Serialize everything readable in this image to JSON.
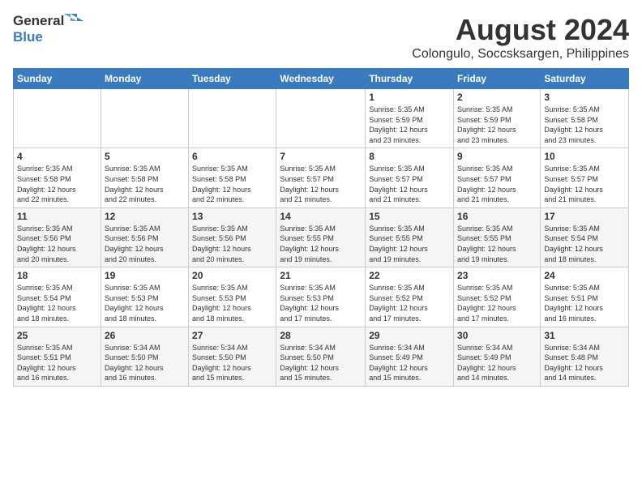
{
  "logo": {
    "general": "General",
    "blue": "Blue"
  },
  "title": "August 2024",
  "subtitle": "Colongulo, Soccsksargen, Philippines",
  "days": [
    "Sunday",
    "Monday",
    "Tuesday",
    "Wednesday",
    "Thursday",
    "Friday",
    "Saturday"
  ],
  "weeks": [
    [
      {
        "day": "",
        "info": ""
      },
      {
        "day": "",
        "info": ""
      },
      {
        "day": "",
        "info": ""
      },
      {
        "day": "",
        "info": ""
      },
      {
        "day": "1",
        "info": "Sunrise: 5:35 AM\nSunset: 5:59 PM\nDaylight: 12 hours\nand 23 minutes."
      },
      {
        "day": "2",
        "info": "Sunrise: 5:35 AM\nSunset: 5:59 PM\nDaylight: 12 hours\nand 23 minutes."
      },
      {
        "day": "3",
        "info": "Sunrise: 5:35 AM\nSunset: 5:58 PM\nDaylight: 12 hours\nand 23 minutes."
      }
    ],
    [
      {
        "day": "4",
        "info": "Sunrise: 5:35 AM\nSunset: 5:58 PM\nDaylight: 12 hours\nand 22 minutes."
      },
      {
        "day": "5",
        "info": "Sunrise: 5:35 AM\nSunset: 5:58 PM\nDaylight: 12 hours\nand 22 minutes."
      },
      {
        "day": "6",
        "info": "Sunrise: 5:35 AM\nSunset: 5:58 PM\nDaylight: 12 hours\nand 22 minutes."
      },
      {
        "day": "7",
        "info": "Sunrise: 5:35 AM\nSunset: 5:57 PM\nDaylight: 12 hours\nand 21 minutes."
      },
      {
        "day": "8",
        "info": "Sunrise: 5:35 AM\nSunset: 5:57 PM\nDaylight: 12 hours\nand 21 minutes."
      },
      {
        "day": "9",
        "info": "Sunrise: 5:35 AM\nSunset: 5:57 PM\nDaylight: 12 hours\nand 21 minutes."
      },
      {
        "day": "10",
        "info": "Sunrise: 5:35 AM\nSunset: 5:57 PM\nDaylight: 12 hours\nand 21 minutes."
      }
    ],
    [
      {
        "day": "11",
        "info": "Sunrise: 5:35 AM\nSunset: 5:56 PM\nDaylight: 12 hours\nand 20 minutes."
      },
      {
        "day": "12",
        "info": "Sunrise: 5:35 AM\nSunset: 5:56 PM\nDaylight: 12 hours\nand 20 minutes."
      },
      {
        "day": "13",
        "info": "Sunrise: 5:35 AM\nSunset: 5:56 PM\nDaylight: 12 hours\nand 20 minutes."
      },
      {
        "day": "14",
        "info": "Sunrise: 5:35 AM\nSunset: 5:55 PM\nDaylight: 12 hours\nand 19 minutes."
      },
      {
        "day": "15",
        "info": "Sunrise: 5:35 AM\nSunset: 5:55 PM\nDaylight: 12 hours\nand 19 minutes."
      },
      {
        "day": "16",
        "info": "Sunrise: 5:35 AM\nSunset: 5:55 PM\nDaylight: 12 hours\nand 19 minutes."
      },
      {
        "day": "17",
        "info": "Sunrise: 5:35 AM\nSunset: 5:54 PM\nDaylight: 12 hours\nand 18 minutes."
      }
    ],
    [
      {
        "day": "18",
        "info": "Sunrise: 5:35 AM\nSunset: 5:54 PM\nDaylight: 12 hours\nand 18 minutes."
      },
      {
        "day": "19",
        "info": "Sunrise: 5:35 AM\nSunset: 5:53 PM\nDaylight: 12 hours\nand 18 minutes."
      },
      {
        "day": "20",
        "info": "Sunrise: 5:35 AM\nSunset: 5:53 PM\nDaylight: 12 hours\nand 18 minutes."
      },
      {
        "day": "21",
        "info": "Sunrise: 5:35 AM\nSunset: 5:53 PM\nDaylight: 12 hours\nand 17 minutes."
      },
      {
        "day": "22",
        "info": "Sunrise: 5:35 AM\nSunset: 5:52 PM\nDaylight: 12 hours\nand 17 minutes."
      },
      {
        "day": "23",
        "info": "Sunrise: 5:35 AM\nSunset: 5:52 PM\nDaylight: 12 hours\nand 17 minutes."
      },
      {
        "day": "24",
        "info": "Sunrise: 5:35 AM\nSunset: 5:51 PM\nDaylight: 12 hours\nand 16 minutes."
      }
    ],
    [
      {
        "day": "25",
        "info": "Sunrise: 5:35 AM\nSunset: 5:51 PM\nDaylight: 12 hours\nand 16 minutes."
      },
      {
        "day": "26",
        "info": "Sunrise: 5:34 AM\nSunset: 5:50 PM\nDaylight: 12 hours\nand 16 minutes."
      },
      {
        "day": "27",
        "info": "Sunrise: 5:34 AM\nSunset: 5:50 PM\nDaylight: 12 hours\nand 15 minutes."
      },
      {
        "day": "28",
        "info": "Sunrise: 5:34 AM\nSunset: 5:50 PM\nDaylight: 12 hours\nand 15 minutes."
      },
      {
        "day": "29",
        "info": "Sunrise: 5:34 AM\nSunset: 5:49 PM\nDaylight: 12 hours\nand 15 minutes."
      },
      {
        "day": "30",
        "info": "Sunrise: 5:34 AM\nSunset: 5:49 PM\nDaylight: 12 hours\nand 14 minutes."
      },
      {
        "day": "31",
        "info": "Sunrise: 5:34 AM\nSunset: 5:48 PM\nDaylight: 12 hours\nand 14 minutes."
      }
    ]
  ]
}
